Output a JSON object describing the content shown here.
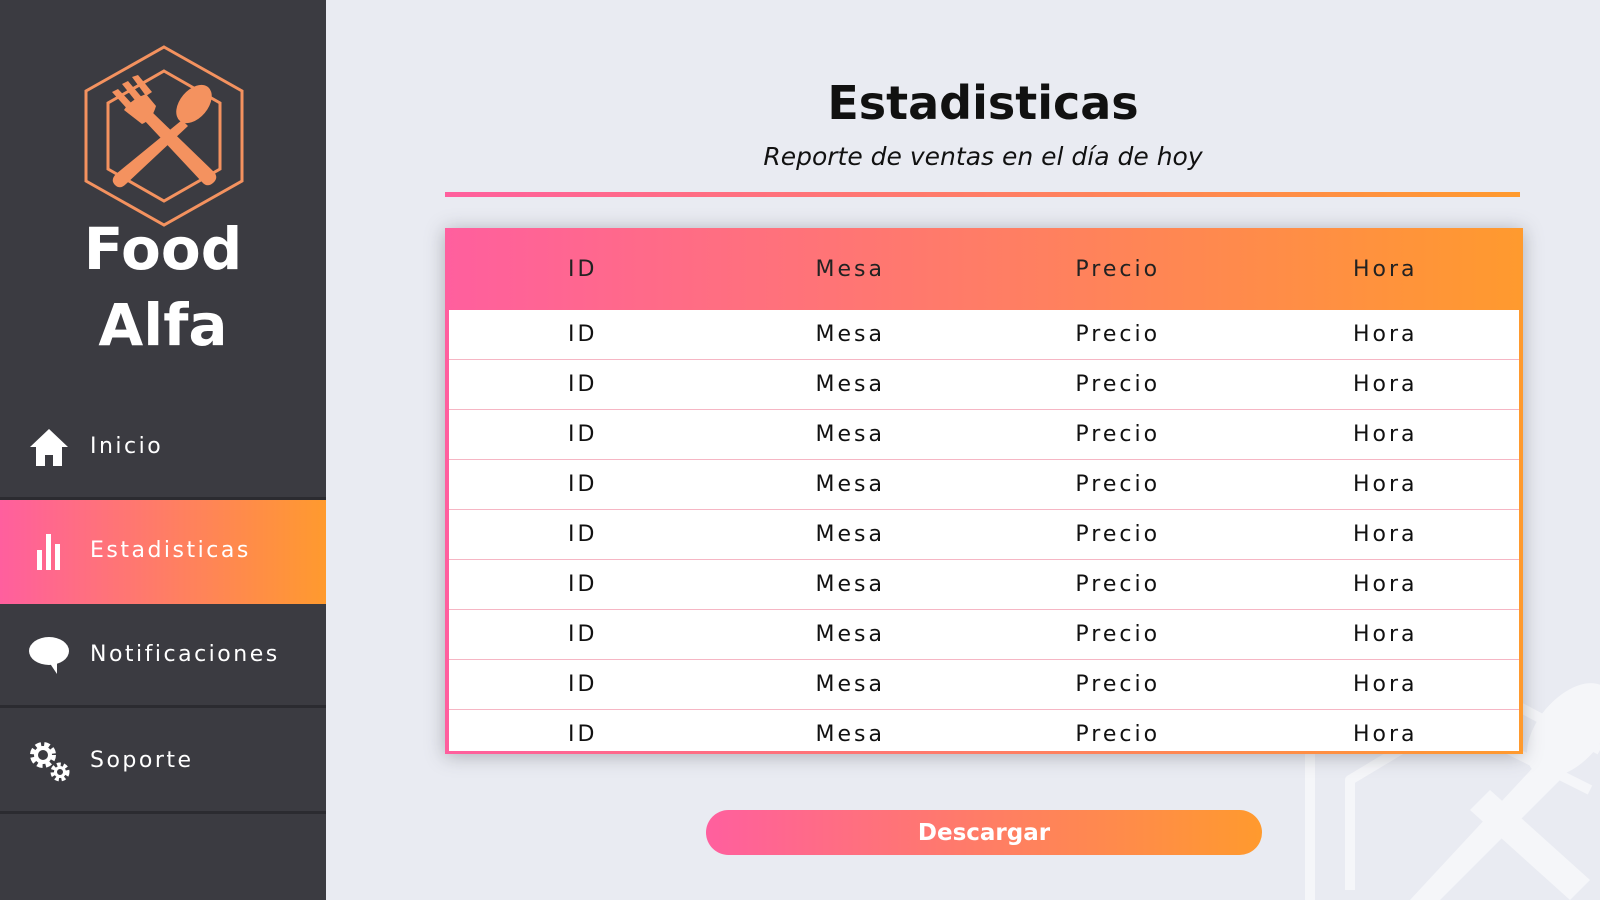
{
  "brand": {
    "line1": "Food",
    "line2": "Alfa",
    "logo_icon": "fork-spoon-hexagon-icon",
    "accent": "#f4925f"
  },
  "sidebar": {
    "items": [
      {
        "label": "Inicio",
        "icon": "home-icon",
        "active": false
      },
      {
        "label": "Estadisticas",
        "icon": "bar-chart-icon",
        "active": true
      },
      {
        "label": "Notificaciones",
        "icon": "speech-bubble-icon",
        "active": false
      },
      {
        "label": "Soporte",
        "icon": "gears-icon",
        "active": false
      }
    ]
  },
  "main": {
    "title": "Estadisticas",
    "subtitle": "Reporte de ventas en el día de hoy"
  },
  "table": {
    "headers": [
      "ID",
      "Mesa",
      "Precio",
      "Hora"
    ],
    "rows": [
      [
        "ID",
        "Mesa",
        "Precio",
        "Hora"
      ],
      [
        "ID",
        "Mesa",
        "Precio",
        "Hora"
      ],
      [
        "ID",
        "Mesa",
        "Precio",
        "Hora"
      ],
      [
        "ID",
        "Mesa",
        "Precio",
        "Hora"
      ],
      [
        "ID",
        "Mesa",
        "Precio",
        "Hora"
      ],
      [
        "ID",
        "Mesa",
        "Precio",
        "Hora"
      ],
      [
        "ID",
        "Mesa",
        "Precio",
        "Hora"
      ],
      [
        "ID",
        "Mesa",
        "Precio",
        "Hora"
      ],
      [
        "ID",
        "Mesa",
        "Precio",
        "Hora"
      ]
    ]
  },
  "actions": {
    "download_label": "Descargar"
  },
  "colors": {
    "gradient_start": "#ff5f9e",
    "gradient_end": "#ff9a2e",
    "sidebar_bg": "#3b3b41",
    "page_bg": "#e9ebf2"
  }
}
